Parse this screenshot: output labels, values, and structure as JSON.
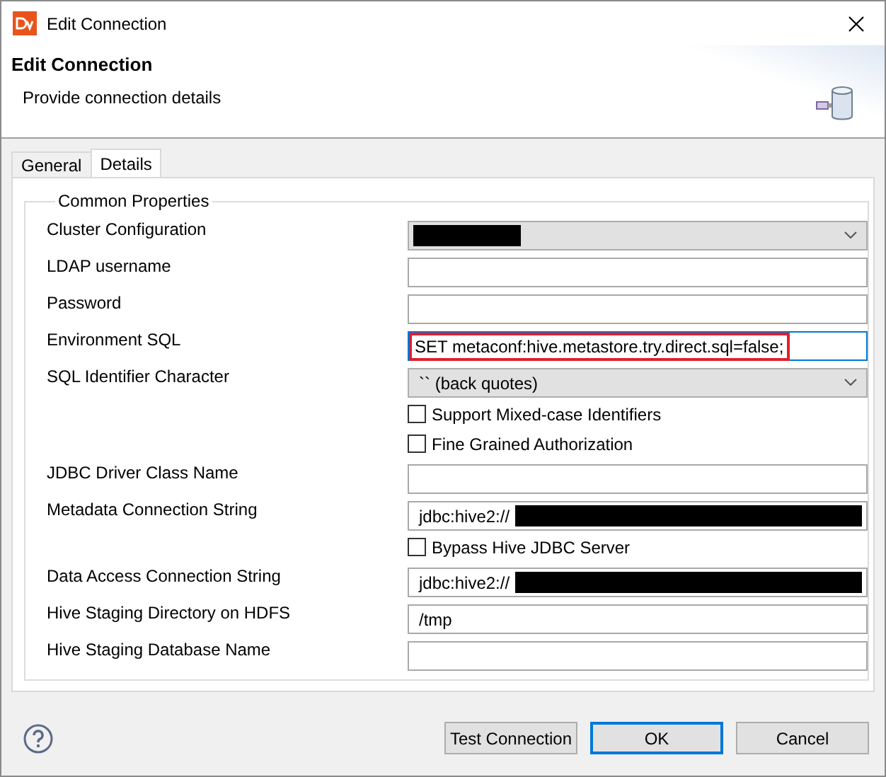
{
  "window": {
    "title": "Edit Connection"
  },
  "header": {
    "title": "Edit Connection",
    "subtitle": "Provide connection details"
  },
  "tabs": [
    {
      "label": "General",
      "selected": false
    },
    {
      "label": "Details",
      "selected": true
    }
  ],
  "group": {
    "title": "Common Properties"
  },
  "rows": [
    {
      "kind": "select",
      "label": "Cluster Configuration",
      "value": "",
      "redacted": true
    },
    {
      "kind": "text",
      "label": "LDAP username",
      "value": ""
    },
    {
      "kind": "text",
      "label": "Password",
      "value": ""
    },
    {
      "kind": "text",
      "label": "Environment SQL",
      "value": "SET metaconf:hive.metastore.try.direct.sql=false;",
      "focused": true,
      "highlighted": true
    },
    {
      "kind": "select",
      "label": "SQL Identifier Character",
      "value": "`` (back quotes)"
    },
    {
      "kind": "checkbox",
      "label": "Support Mixed-case Identifiers",
      "checked": false
    },
    {
      "kind": "checkbox",
      "label": "Fine Grained Authorization",
      "checked": false
    },
    {
      "kind": "text",
      "label": "JDBC Driver Class Name",
      "value": ""
    },
    {
      "kind": "text",
      "label": "Metadata Connection String",
      "value": "jdbc:hive2://",
      "redacted": true
    },
    {
      "kind": "checkbox",
      "label": "Bypass Hive JDBC Server",
      "checked": false
    },
    {
      "kind": "text",
      "label": "Data Access Connection String",
      "value": "jdbc:hive2://",
      "redacted": true
    },
    {
      "kind": "text",
      "label": "Hive Staging Directory on HDFS",
      "value": "/tmp"
    },
    {
      "kind": "text",
      "label": "Hive Staging Database Name",
      "value": ""
    }
  ],
  "buttons": [
    {
      "label": "Test Connection",
      "default": false
    },
    {
      "label": "OK",
      "default": true
    },
    {
      "label": "Cancel",
      "default": false
    }
  ]
}
